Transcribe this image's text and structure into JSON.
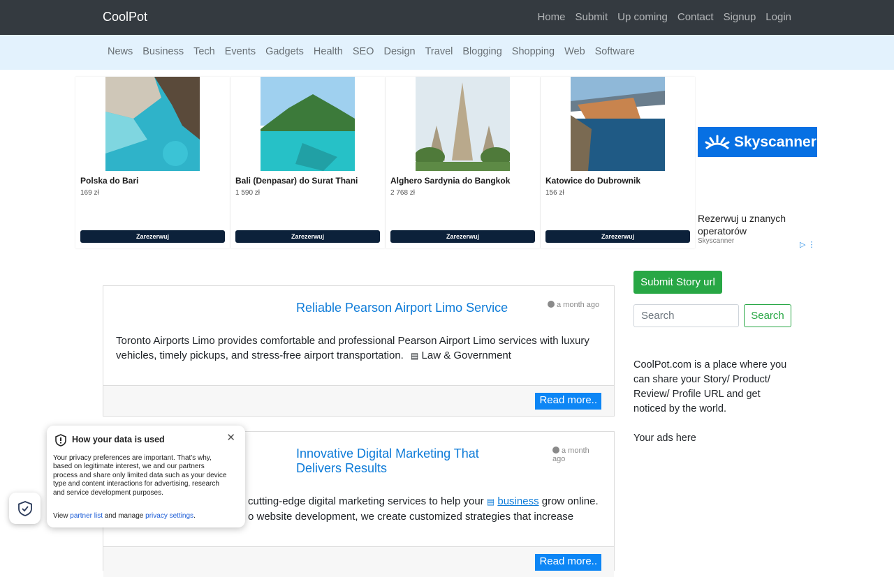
{
  "navbar": {
    "brand": "CoolPot",
    "links": [
      "Home",
      "Submit",
      "Up coming",
      "Contact",
      "Signup",
      "Login"
    ]
  },
  "categories": [
    "News",
    "Business",
    "Tech",
    "Events",
    "Gadgets",
    "Health",
    "SEO",
    "Design",
    "Travel",
    "Blogging",
    "Shopping",
    "Web",
    "Software"
  ],
  "ad": {
    "cards": [
      {
        "title": "Polska do Bari",
        "price": "169 zł",
        "button": "Zarezerwuj"
      },
      {
        "title": "Bali (Denpasar) do Surat Thani",
        "price": "1 590 zł",
        "button": "Zarezerwuj"
      },
      {
        "title": "Alghero Sardynia do Bangkok",
        "price": "2 768 zł",
        "button": "Zarezerwuj"
      },
      {
        "title": "Katowice do Dubrownik",
        "price": "156 zł",
        "button": "Zarezerwuj"
      }
    ],
    "sponsor_logo": "Skyscanner",
    "headline": "Rezerwuj u znanych operatorów",
    "source": "Skyscanner"
  },
  "stories": [
    {
      "title": "Reliable Pearson Airport Limo Service",
      "time": "a month ago",
      "text": "Toronto Airports Limo provides comfortable and professional Pearson Airport Limo services with luxury vehicles, timely pickups, and stress-free airport transportation.",
      "category": "Law & Government",
      "read_more": "Read more.."
    },
    {
      "title": "Innovative Digital Marketing That Delivers Results",
      "time": "a month ago",
      "text_before": "cutting-edge digital marketing services to help your",
      "category": "business",
      "text_after": "grow online.",
      "text_line2": "o website development, we create customized strategies that increase",
      "read_more": "Read more.."
    }
  ],
  "sidebar": {
    "submit_label": "Submit Story url",
    "search_placeholder": "Search",
    "search_button": "Search",
    "about": "CoolPot.com is a place where you can share your Story/ Product/ Review/ Profile URL and get noticed by the world.",
    "ads": "Your ads here"
  },
  "privacy": {
    "title": "How your data is used",
    "body": "Your privacy preferences are important. That's why, based on legitimate interest, we and our partners process and share only limited data such as your device type and content interactions for advertising, research and service development purposes.",
    "foot_view": "View",
    "partner_link": "partner list",
    "foot_manage": "and manage",
    "settings_link": "privacy settings",
    "foot_end": "."
  }
}
